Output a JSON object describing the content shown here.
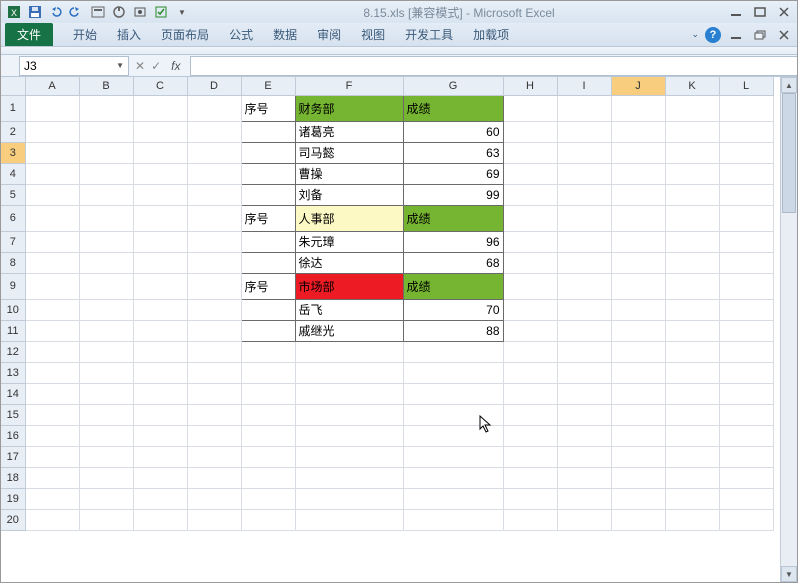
{
  "window": {
    "title": "8.15.xls [兼容模式] - Microsoft Excel"
  },
  "qat": {
    "save": "保存",
    "undo": "撤销",
    "redo": "重做"
  },
  "ribbon": {
    "file": "文件",
    "tabs": [
      "开始",
      "插入",
      "页面布局",
      "公式",
      "数据",
      "审阅",
      "视图",
      "开发工具",
      "加载项"
    ]
  },
  "formula": {
    "nameBox": "J3",
    "fx": "fx",
    "value": ""
  },
  "columns": [
    "A",
    "B",
    "C",
    "D",
    "E",
    "F",
    "G",
    "H",
    "I",
    "J",
    "K",
    "L"
  ],
  "rowCount": 20,
  "colWidths": {
    "A": 54,
    "B": 54,
    "C": 54,
    "D": 54,
    "E": 54,
    "F": 108,
    "G": 100,
    "H": 54,
    "I": 54,
    "J": 54,
    "K": 54,
    "L": 54
  },
  "selected": {
    "col": "J",
    "row": 3
  },
  "chart_data": {
    "type": "table",
    "sections": [
      {
        "header": {
          "seq": "序号",
          "dept": "财务部",
          "score": "成绩",
          "deptFill": "green"
        },
        "rows": [
          {
            "name": "诸葛亮",
            "score": 60
          },
          {
            "name": "司马懿",
            "score": 63
          },
          {
            "name": "曹操",
            "score": 69
          },
          {
            "name": "刘备",
            "score": 99
          }
        ]
      },
      {
        "header": {
          "seq": "序号",
          "dept": "人事部",
          "score": "成绩",
          "deptFill": "yellow"
        },
        "rows": [
          {
            "name": "朱元璋",
            "score": 96
          },
          {
            "name": "徐达",
            "score": 68
          }
        ]
      },
      {
        "header": {
          "seq": "序号",
          "dept": "市场部",
          "score": "成绩",
          "deptFill": "red"
        },
        "rows": [
          {
            "name": "岳飞",
            "score": 70
          },
          {
            "name": "戚继光",
            "score": 88
          }
        ]
      }
    ]
  }
}
